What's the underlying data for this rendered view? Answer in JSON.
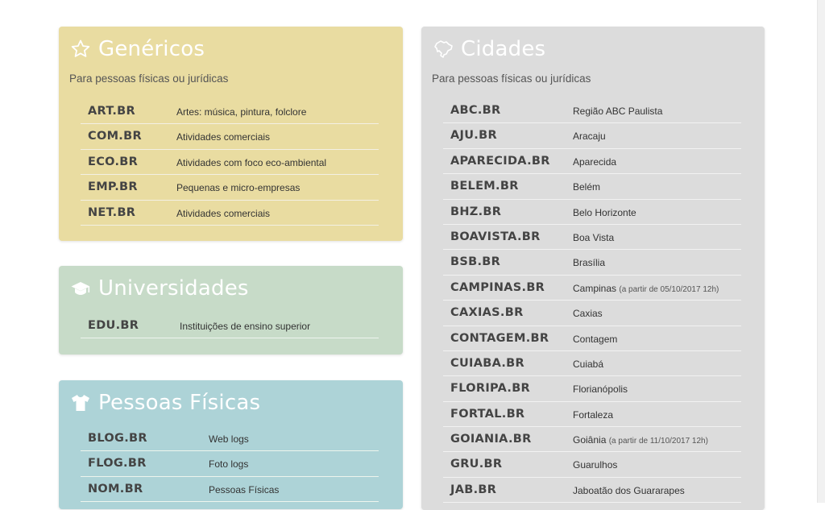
{
  "panels": {
    "generic": {
      "title": "Genéricos",
      "subtitle": "Para pessoas físicas ou jurídicas",
      "icon": "star-icon",
      "color": "#e9dca1",
      "items": [
        {
          "domain": "ART.BR",
          "desc": "Artes: música, pintura, folclore"
        },
        {
          "domain": "COM.BR",
          "desc": "Atividades comerciais"
        },
        {
          "domain": "ECO.BR",
          "desc": "Atividades com foco eco-ambiental"
        },
        {
          "domain": "EMP.BR",
          "desc": "Pequenas e micro-empresas"
        },
        {
          "domain": "NET.BR",
          "desc": "Atividades comerciais"
        }
      ]
    },
    "universities": {
      "title": "Universidades",
      "icon": "graduation-cap-icon",
      "color": "#c7dbc8",
      "items": [
        {
          "domain": "EDU.BR",
          "desc": "Instituições de ensino superior"
        }
      ]
    },
    "persons": {
      "title": "Pessoas Físicas",
      "icon": "tshirt-icon",
      "color": "#add3d7",
      "items": [
        {
          "domain": "BLOG.BR",
          "desc": "Web logs"
        },
        {
          "domain": "FLOG.BR",
          "desc": "Foto logs"
        },
        {
          "domain": "NOM.BR",
          "desc": "Pessoas Físicas"
        }
      ]
    },
    "cities": {
      "title": "Cidades",
      "subtitle": "Para pessoas físicas ou jurídicas",
      "icon": "brazil-map-icon",
      "color": "#dcdcdc",
      "items": [
        {
          "domain": "ABC.BR",
          "desc": "Região ABC Paulista",
          "note": ""
        },
        {
          "domain": "AJU.BR",
          "desc": "Aracaju",
          "note": ""
        },
        {
          "domain": "APARECIDA.BR",
          "desc": "Aparecida",
          "note": ""
        },
        {
          "domain": "BELEM.BR",
          "desc": "Belém",
          "note": ""
        },
        {
          "domain": "BHZ.BR",
          "desc": "Belo Horizonte",
          "note": ""
        },
        {
          "domain": "BOAVISTA.BR",
          "desc": "Boa Vista",
          "note": ""
        },
        {
          "domain": "BSB.BR",
          "desc": "Brasília",
          "note": ""
        },
        {
          "domain": "CAMPINAS.BR",
          "desc": "Campinas",
          "note": "(a partir de 05/10/2017 12h)"
        },
        {
          "domain": "CAXIAS.BR",
          "desc": "Caxias",
          "note": ""
        },
        {
          "domain": "CONTAGEM.BR",
          "desc": "Contagem",
          "note": ""
        },
        {
          "domain": "CUIABA.BR",
          "desc": "Cuiabá",
          "note": ""
        },
        {
          "domain": "FLORIPA.BR",
          "desc": "Florianópolis",
          "note": ""
        },
        {
          "domain": "FORTAL.BR",
          "desc": "Fortaleza",
          "note": ""
        },
        {
          "domain": "GOIANIA.BR",
          "desc": "Goiânia",
          "note": "(a partir de 11/10/2017 12h)"
        },
        {
          "domain": "GRU.BR",
          "desc": "Guarulhos",
          "note": ""
        },
        {
          "domain": "JAB.BR",
          "desc": "Jaboatão dos Guararapes",
          "note": ""
        }
      ]
    }
  }
}
